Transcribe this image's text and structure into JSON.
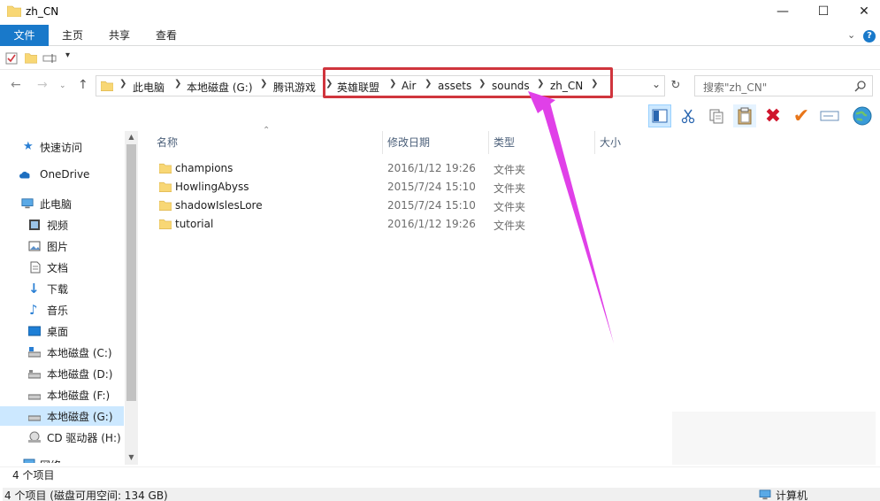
{
  "window": {
    "title": "zh_CN"
  },
  "ribbon": {
    "tabs": [
      "文件",
      "主页",
      "共享",
      "查看"
    ]
  },
  "address": {
    "crumbs": [
      "此电脑",
      "本地磁盘 (G:)",
      "腾讯游戏",
      "英雄联盟",
      "Air",
      "assets",
      "sounds",
      "zh_CN"
    ]
  },
  "search": {
    "placeholder": "搜索\"zh_CN\""
  },
  "sidebar": {
    "items": [
      {
        "label": "快速访问",
        "icon": "star-icon"
      },
      {
        "label": "OneDrive",
        "icon": "cloud-icon"
      },
      {
        "label": "此电脑",
        "icon": "computer-icon"
      },
      {
        "label": "视频",
        "icon": "video-icon"
      },
      {
        "label": "图片",
        "icon": "picture-icon"
      },
      {
        "label": "文档",
        "icon": "document-icon"
      },
      {
        "label": "下载",
        "icon": "download-icon"
      },
      {
        "label": "音乐",
        "icon": "music-icon"
      },
      {
        "label": "桌面",
        "icon": "desktop-icon"
      },
      {
        "label": "本地磁盘 (C:)",
        "icon": "drive-icon"
      },
      {
        "label": "本地磁盘 (D:)",
        "icon": "drive-icon"
      },
      {
        "label": "本地磁盘 (F:)",
        "icon": "drive-icon"
      },
      {
        "label": "本地磁盘 (G:)",
        "icon": "drive-icon"
      },
      {
        "label": "CD 驱动器 (H:)",
        "icon": "cd-icon"
      },
      {
        "label": "网络",
        "icon": "network-icon"
      }
    ]
  },
  "columns": {
    "name": "名称",
    "modified": "修改日期",
    "type": "类型",
    "size": "大小"
  },
  "files": [
    {
      "name": "champions",
      "modified": "2016/1/12 19:26",
      "type": "文件夹"
    },
    {
      "name": "HowlingAbyss",
      "modified": "2015/7/24 15:10",
      "type": "文件夹"
    },
    {
      "name": "shadowIslesLore",
      "modified": "2015/7/24 15:10",
      "type": "文件夹"
    },
    {
      "name": "tutorial",
      "modified": "2016/1/12 19:26",
      "type": "文件夹"
    }
  ],
  "status": {
    "count": "4 个项目",
    "disk": "4 个项目 (磁盘可用空间: 134 GB)",
    "location": "计算机"
  },
  "colors": {
    "accent": "#1979ca",
    "highlight_box": "#d0353d",
    "annotation_arrow": "#e040e8",
    "folder": "#f8d775"
  }
}
